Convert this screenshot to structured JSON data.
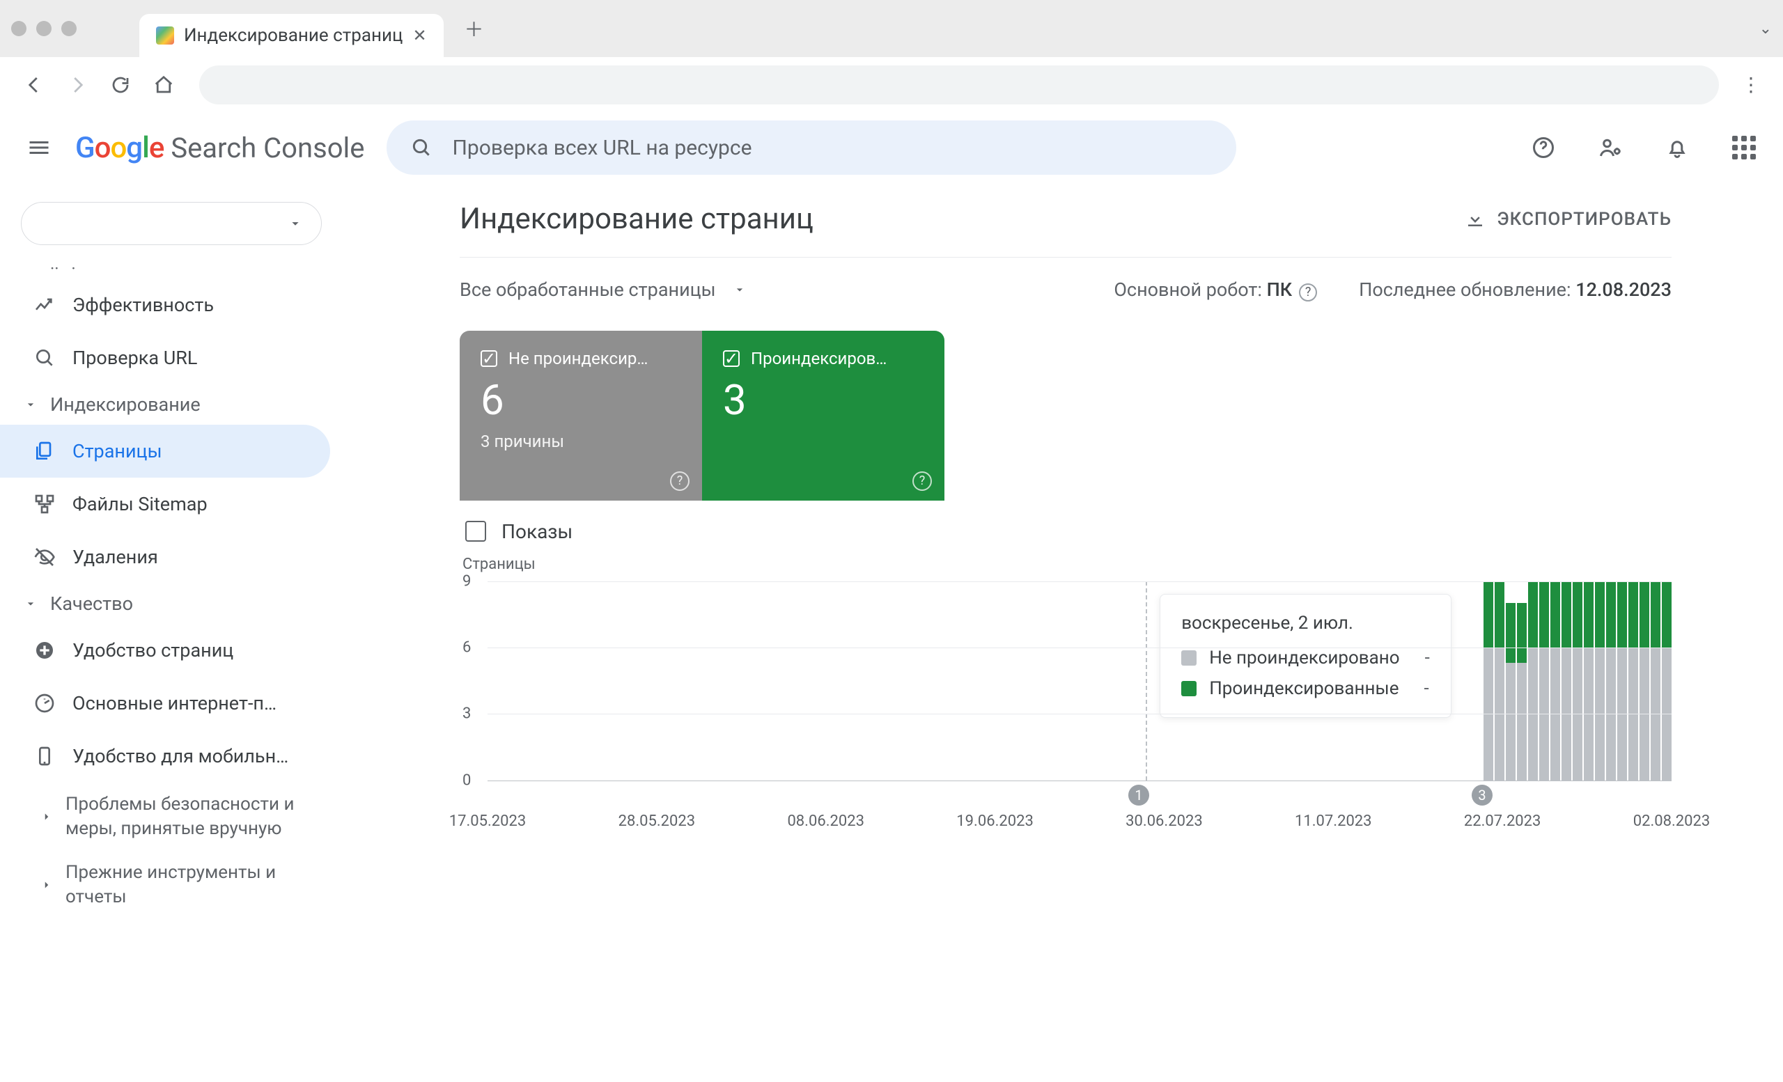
{
  "browser": {
    "tab_title": "Индексирование страниц"
  },
  "logo": {
    "search": "Search",
    "console": "Console"
  },
  "header": {
    "search_placeholder": "Проверка всех URL на ресурсе"
  },
  "sidebar": {
    "perf": "Эффективность",
    "url_inspect": "Проверка URL",
    "section_index": "Индексирование",
    "pages": "Страницы",
    "sitemaps": "Файлы Sitemap",
    "removals": "Удаления",
    "section_quality": "Качество",
    "page_experience": "Удобство страниц",
    "cwv": "Основные интернет-п…",
    "mobile": "Удобство для мобильн…",
    "security": "Проблемы безопасности и меры, принятые вручную",
    "legacy": "Прежние инструменты и отчеты"
  },
  "main": {
    "title": "Индексирование страниц",
    "export": "ЭКСПОРТИРОВАТЬ",
    "filter": "Все обработанные страницы",
    "robot_label": "Основной робот: ",
    "robot_value": "ПК",
    "updated_label": "Последнее обновление: ",
    "updated_value": "12.08.2023"
  },
  "tabs": {
    "not_indexed_label": "Не проиндексир…",
    "not_indexed_value": "6",
    "not_indexed_sub": "3 причины",
    "indexed_label": "Проиндексиров…",
    "indexed_value": "3"
  },
  "impressions_label": "Показы",
  "chart": {
    "ylabel": "Страницы",
    "yticks": [
      "9",
      "6",
      "3",
      "0"
    ]
  },
  "tooltip": {
    "title": "воскресенье, 2 июл.",
    "not_indexed": "Не проиндексировано",
    "indexed": "Проиндексированные",
    "dash": "-"
  },
  "markers": {
    "m1": "1",
    "m3": "3"
  },
  "xticks": [
    "17.05.2023",
    "28.05.2023",
    "08.06.2023",
    "19.06.2023",
    "30.06.2023",
    "11.07.2023",
    "22.07.2023",
    "02.08.2023"
  ],
  "chart_data": {
    "type": "bar",
    "title": "Страницы",
    "xlabel": "",
    "ylabel": "Страницы",
    "ylim": [
      0,
      9
    ],
    "categories": [
      "17.05.2023",
      "28.05.2023",
      "08.06.2023",
      "19.06.2023",
      "30.06.2023",
      "11.07.2023",
      "22.07.2023",
      "02.08.2023"
    ],
    "series": [
      {
        "name": "Не проиндексировано",
        "color": "#bdc1c6",
        "values_by_category": {
          "02.08.2023": 6
        },
        "note": "Values are only visible for the rightmost date range; earlier dates show no bars (approx. 0)."
      },
      {
        "name": "Проиндексированные",
        "color": "#1E8E3E",
        "values_by_category": {
          "02.08.2023": 3
        }
      }
    ],
    "hover_dates": [
      "воскресенье, 2 июл."
    ],
    "markers": [
      {
        "label": "1",
        "approx_x_category": "30.06.2023"
      },
      {
        "label": "3",
        "approx_x_category": "02.08.2023"
      }
    ],
    "stacked_bar_segment_detail": [
      {
        "grey": 6,
        "green": 3
      },
      {
        "grey": 6,
        "green": 3
      },
      {
        "grey": 5.3,
        "green": 2.7
      },
      {
        "grey": 5.3,
        "green": 2.7
      },
      {
        "grey": 6,
        "green": 3
      },
      {
        "grey": 6,
        "green": 3
      },
      {
        "grey": 6,
        "green": 3
      },
      {
        "grey": 6,
        "green": 3
      },
      {
        "grey": 6,
        "green": 3
      },
      {
        "grey": 6,
        "green": 3
      },
      {
        "grey": 6,
        "green": 3
      },
      {
        "grey": 6,
        "green": 3
      },
      {
        "grey": 6,
        "green": 3
      },
      {
        "grey": 6,
        "green": 3
      },
      {
        "grey": 6,
        "green": 3
      },
      {
        "grey": 6,
        "green": 3
      },
      {
        "grey": 6,
        "green": 3
      }
    ]
  }
}
